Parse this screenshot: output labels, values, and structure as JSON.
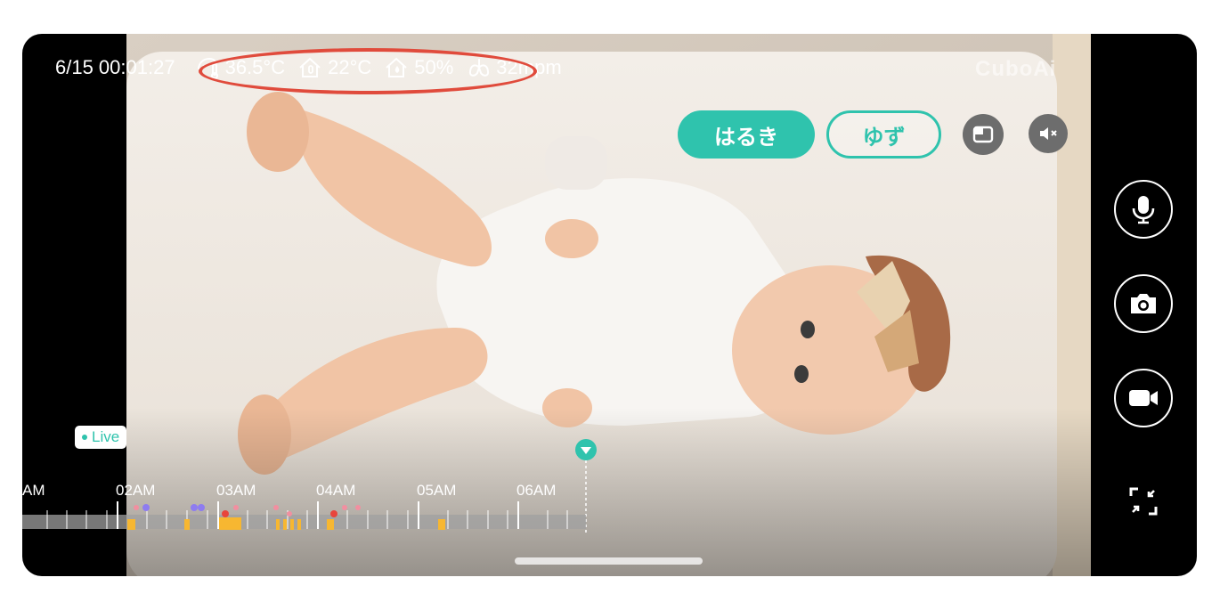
{
  "status": {
    "datetime": "6/15 00:01:27",
    "body_temp": "36.5°C",
    "room_temp": "22°C",
    "humidity": "50%",
    "breathing": "32mpm",
    "icons": [
      "baby-temp-icon",
      "room-temp-icon",
      "humidity-icon",
      "lungs-icon"
    ]
  },
  "brand": "CuboAi",
  "profiles": [
    {
      "label": "はるき",
      "active": true
    },
    {
      "label": "ゆず",
      "active": false
    }
  ],
  "live_label": "Live",
  "timeline": {
    "ticks": [
      "AM",
      "02AM",
      "03AM",
      "04AM",
      "05AM",
      "06AM"
    ]
  },
  "colors": {
    "accent": "#2fc3ad",
    "highlight_ring": "#e04b3c",
    "event_yellow": "#f7b731",
    "event_red": "#e8453c",
    "event_purple": "#8e7cf0",
    "event_pink": "#f28fa0"
  }
}
